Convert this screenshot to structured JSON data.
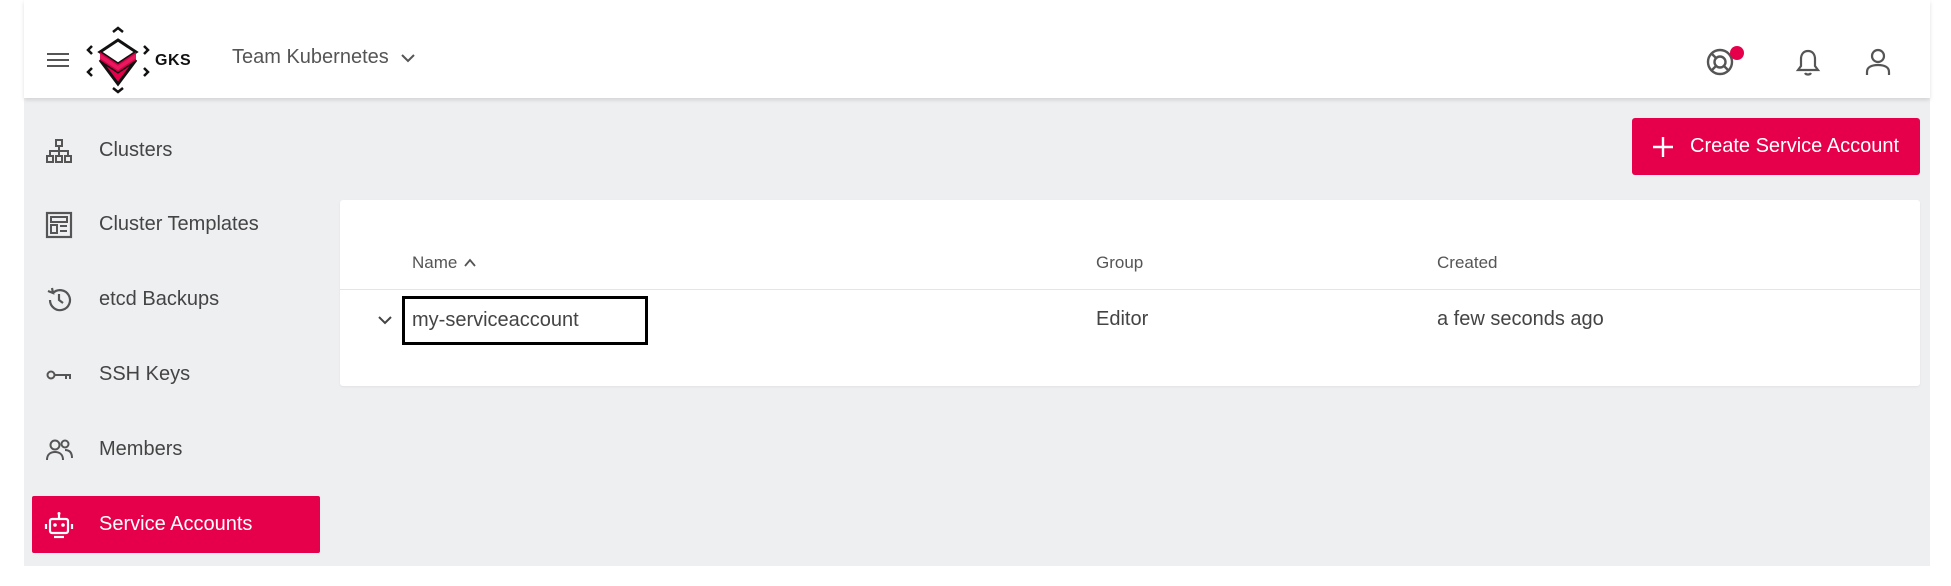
{
  "header": {
    "logo_text": "GKS",
    "project_name": "Team Kubernetes"
  },
  "sidebar": {
    "items": [
      {
        "label": "Clusters",
        "icon": "sitemap-icon"
      },
      {
        "label": "Cluster Templates",
        "icon": "template-icon"
      },
      {
        "label": "etcd Backups",
        "icon": "history-icon"
      },
      {
        "label": "SSH Keys",
        "icon": "key-icon"
      },
      {
        "label": "Members",
        "icon": "members-icon"
      },
      {
        "label": "Service Accounts",
        "icon": "robot-icon",
        "active": true
      }
    ]
  },
  "toolbar": {
    "create_label": "Create Service Account"
  },
  "table": {
    "columns": [
      "Name",
      "Group",
      "Created"
    ],
    "rows": [
      {
        "name": "my-serviceaccount",
        "group": "Editor",
        "created": "a few seconds ago"
      }
    ]
  },
  "colors": {
    "accent": "#e6004c",
    "background": "#eeeff1"
  }
}
